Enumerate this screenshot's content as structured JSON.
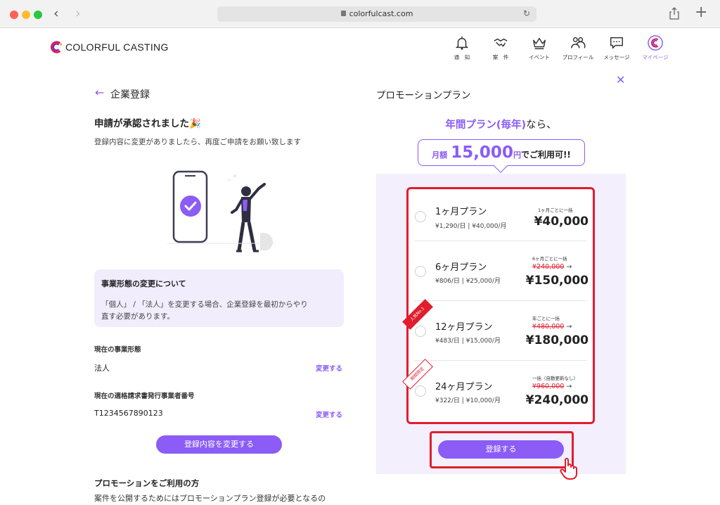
{
  "browser": {
    "url": "colorfulcast.com"
  },
  "site": {
    "logo_text": "COLORFUL CASTING",
    "nav": [
      {
        "label": "通　知",
        "icon": "bell-icon"
      },
      {
        "label": "案　件",
        "icon": "handshake-icon"
      },
      {
        "label": "イベント",
        "icon": "crown-icon"
      },
      {
        "label": "プロフィール",
        "icon": "people-icon"
      },
      {
        "label": "メッセージ",
        "icon": "chat-icon"
      },
      {
        "label": "マイページ",
        "icon": "mypage-logo-icon"
      }
    ]
  },
  "left": {
    "title": "企業登録",
    "approved_heading": "申請が承認されました🎉",
    "approved_sub": "登録内容に変更がありましたら、再度ご申請をお願い致します",
    "notice": {
      "title": "事業形態の変更について",
      "body_line1": "「個人」 / 「法人」を変更する場合、企業登録を最初からやり",
      "body_line2": "直す必要があります。"
    },
    "business_type": {
      "label": "現在の事業形態",
      "value": "法人",
      "change": "変更する"
    },
    "invoice_number": {
      "label": "現在の適格請求書発行事業者番号",
      "value": "T1234567890123",
      "change": "変更する"
    },
    "change_button": "登録内容を変更する",
    "promo_heading": "プロモーションをご利用の方",
    "promo_sub": "案件を公開するためにはプロモーションプラン登録が必要となるの"
  },
  "right": {
    "title": "プロモーションプラン",
    "yearly_hl": "年間プラン(毎年)",
    "yearly_rest": "なら、",
    "monthly_pre": "月額",
    "monthly_amount": "15,000",
    "monthly_unit": "円",
    "monthly_post": "でご利用可!!",
    "plans": [
      {
        "name": "1ヶ月プラン",
        "rate": "¥1,290/日 | ¥40,000/月",
        "note": "1ヶ月ごとに一括",
        "old_price": "",
        "price": "¥40,000",
        "ribbon": ""
      },
      {
        "name": "6ヶ月プラン",
        "rate": "¥806/日 | ¥25,000/月",
        "note": "6ヶ月ごとに一括",
        "old_price": "¥240,000",
        "price": "¥150,000",
        "ribbon": ""
      },
      {
        "name": "12ヶ月プラン",
        "rate": "¥483/日 | ¥15,000/月",
        "note": "年ごとに一括",
        "old_price": "¥480,000",
        "price": "¥180,000",
        "ribbon": "人気No.1"
      },
      {
        "name": "24ヶ月プラン",
        "rate": "¥322/日 | ¥10,000/月",
        "note": "一括（自動更新なし）",
        "old_price": "¥960,000",
        "price": "¥240,000",
        "ribbon": "期間限定"
      }
    ],
    "register_button": "登録する"
  },
  "colors": {
    "accent": "#8b5cf6",
    "highlight_red": "#e11d2e",
    "panel_bg": "#f3effd"
  }
}
